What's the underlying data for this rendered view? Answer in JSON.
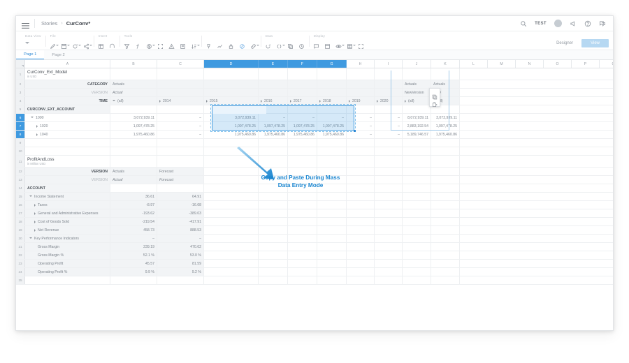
{
  "header": {
    "menu_icon": "hamburger-icon",
    "breadcrumb_root": "Stories",
    "breadcrumb_sep": "›",
    "breadcrumb_current": "CurConv*",
    "search_icon": "search-icon",
    "tenant_label": "TEST",
    "avatar": "user-avatar",
    "notify_icon": "megaphone-icon",
    "help_icon": "help-icon",
    "chat_icon": "chat-icon"
  },
  "toolbar": {
    "groups": [
      {
        "title": "Data View",
        "icons": [
          "chevron-down-icon"
        ]
      },
      {
        "title": "File",
        "icons": [
          "edit-pencil-icon",
          "save-icon",
          "refresh-icon",
          "share-icon"
        ]
      },
      {
        "title": "Insert",
        "icons": [
          "table-icon",
          "shape-icon"
        ]
      },
      {
        "title": "Tools",
        "icons": [
          "filter-icon",
          "formula-icon",
          "currency-icon",
          "expand-icon",
          "alert-icon",
          "note-icon",
          "sort-icon",
          "pin-icon",
          "trend-icon",
          "lock-icon",
          "data-locking-icon",
          "link-icon"
        ]
      },
      {
        "title": "Data",
        "icons": [
          "refresh-data-icon",
          "parentheses-icon",
          "copy-icon",
          "history-icon"
        ]
      },
      {
        "title": "Display",
        "icons": [
          "comment-icon",
          "layout-icon",
          "visibility-icon",
          "grid-icon",
          "fullscreen-icon"
        ]
      }
    ],
    "designer_label": "Designer",
    "view_label": "View",
    "accent_color": "#3f9ae0"
  },
  "page_tabs": [
    {
      "label": "Page 1",
      "active": true
    },
    {
      "label": "Page 2",
      "active": false
    }
  ],
  "grid": {
    "columns": [
      {
        "label": "A",
        "width": 122,
        "selected": false
      },
      {
        "label": "B",
        "width": 67,
        "selected": false
      },
      {
        "label": "C",
        "width": 67,
        "selected": false
      },
      {
        "label": "D",
        "width": 78,
        "selected": true
      },
      {
        "label": "E",
        "width": 42,
        "selected": true
      },
      {
        "label": "F",
        "width": 42,
        "selected": true
      },
      {
        "label": "G",
        "width": 42,
        "selected": true
      },
      {
        "label": "H",
        "width": 40,
        "selected": false
      },
      {
        "label": "I",
        "width": 40,
        "selected": false
      },
      {
        "label": "J",
        "width": 41,
        "selected": false
      },
      {
        "label": "K",
        "width": 41,
        "selected": false
      },
      {
        "label": "L",
        "width": 40,
        "selected": false
      },
      {
        "label": "M",
        "width": 40,
        "selected": false
      },
      {
        "label": "N",
        "width": 40,
        "selected": false
      },
      {
        "label": "O",
        "width": 40,
        "selected": false
      },
      {
        "label": "P",
        "width": 40,
        "selected": false
      },
      {
        "label": "Q",
        "width": 40,
        "selected": false
      }
    ],
    "row_numbers": [
      "1",
      "2",
      "3",
      "4",
      "5",
      "6",
      "7",
      "8",
      "9",
      "10",
      "11",
      "12",
      "13",
      "14",
      "15",
      "16",
      "17",
      "18",
      "19",
      "20",
      "21",
      "22",
      "23",
      "24",
      "25"
    ],
    "selected_rows": [
      "6",
      "7",
      "8"
    ]
  },
  "table_top": {
    "title": "CurConv_Ext_Model",
    "subtitle": "in USD",
    "category_label": "CATEGORY",
    "category_value": "Actuals",
    "version_label": "VERSION",
    "version_value": "Actual",
    "time_label": "TIME",
    "time_value": "(all)",
    "years": [
      "2014",
      "2015",
      "2016",
      "2017",
      "2018",
      "2019",
      "2020"
    ],
    "extra_headers": [
      {
        "cat": "Actuals",
        "ver": "NewVersion",
        "time": "(all)"
      },
      {
        "cat": "Actuals",
        "ver": "USD",
        "time": "(all)"
      }
    ],
    "account_label": "CURCONV_EXT_ACCOUNT",
    "rows": [
      {
        "id": "1000",
        "indent": 0,
        "total": "3,072,939.11",
        "years": [
          "–",
          "3,072,939.11",
          "–",
          "–",
          "–",
          "–",
          "–"
        ],
        "extra": [
          "8,072,939.11",
          "3,072,939.11"
        ]
      },
      {
        "id": "1020",
        "indent": 1,
        "total": "1,097,478.25",
        "years": [
          "–",
          "1,097,478.25",
          "1,097,478.25",
          "1,097,478.25",
          "1,097,478.25",
          "–",
          "–"
        ],
        "extra": [
          "2,883,192.54",
          "1,097,478.25"
        ]
      },
      {
        "id": "1040",
        "indent": 1,
        "total": "1,975,460.86",
        "years": [
          "–",
          "1,975,460.86",
          "1,975,460.86",
          "1,975,460.86",
          "1,975,460.86",
          "–",
          "–"
        ],
        "extra": [
          "5,189,746.57",
          "1,975,460.86"
        ]
      }
    ]
  },
  "table_bottom": {
    "title": "ProfitAndLoss",
    "subtitle": "in Million USD",
    "version_label": "VERSION",
    "version_values": [
      "Actuals",
      "Forecast"
    ],
    "version_label2": "VERSION",
    "version_values2": [
      "Actual",
      "Forecast"
    ],
    "account_label": "ACCOUNT",
    "rows": [
      {
        "label": "Income Statement",
        "indent": 0,
        "marker": "collapse",
        "values": [
          "36.61",
          "64.91"
        ]
      },
      {
        "label": "Taxes",
        "indent": 1,
        "marker": "expand",
        "values": [
          "-8.97",
          "-16.68"
        ]
      },
      {
        "label": "General and Administrative Expenses",
        "indent": 1,
        "marker": "expand",
        "values": [
          "-193.62",
          "-389.03"
        ]
      },
      {
        "label": "Cost of Goods Sold",
        "indent": 1,
        "marker": "expand",
        "values": [
          "-219.54",
          "-417.91"
        ]
      },
      {
        "label": "Net Revenue",
        "indent": 1,
        "marker": "expand",
        "values": [
          "458.73",
          "888.53"
        ]
      },
      {
        "label": "Key Performance Indicators",
        "indent": 0,
        "marker": "collapse",
        "values": [
          "–",
          "–"
        ]
      },
      {
        "label": "Gross Margin",
        "indent": 2,
        "marker": "none",
        "values": [
          "239.19",
          "470.62"
        ]
      },
      {
        "label": "Gross Margin %",
        "indent": 2,
        "marker": "none",
        "values": [
          "52.1 %",
          "53.0 %"
        ]
      },
      {
        "label": "Operating Profit",
        "indent": 2,
        "marker": "none",
        "values": [
          "45.57",
          "81.59"
        ]
      },
      {
        "label": "Operating Profit %",
        "indent": 2,
        "marker": "none",
        "values": [
          "9.9 %",
          "9.2 %"
        ]
      }
    ]
  },
  "floating_toolbar": {
    "copy_icon": "copy-icon",
    "paste_icon": "paste-icon"
  },
  "callout": {
    "line1": "Copy and Paste During Mass",
    "line2": "Data Entry Mode",
    "color": "#1b86d0",
    "arrow": "arrow-pointing-up-left"
  }
}
